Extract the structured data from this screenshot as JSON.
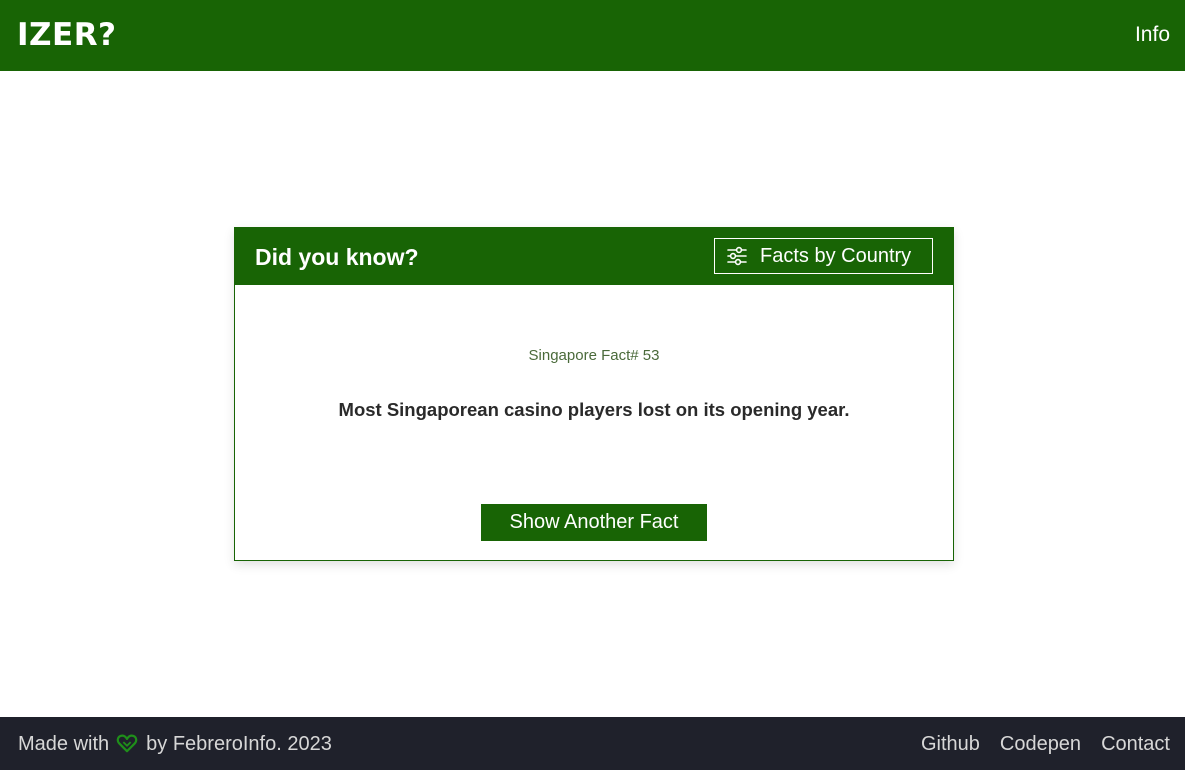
{
  "header": {
    "logo": "IZER?",
    "info_link": "Info"
  },
  "card": {
    "title": "Did you know?",
    "country_button": "Facts by Country",
    "country_button_icon": "sliders-icon",
    "fact_number": "Singapore Fact# 53",
    "fact_text": "Most Singaporean casino players lost on its opening year.",
    "another_button": "Show Another Fact"
  },
  "footer": {
    "made_with": "Made with",
    "heart_icon": "heart-icon",
    "by_text": "by FebreroInfo. 2023",
    "links": [
      "Github",
      "Codepen",
      "Contact"
    ]
  },
  "colors": {
    "brand_green": "#186405",
    "footer_bg": "#1f212b",
    "footer_text": "#d7d7d7"
  }
}
